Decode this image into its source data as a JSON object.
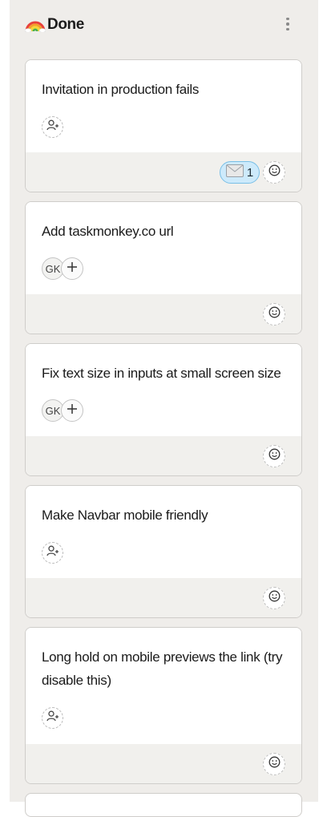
{
  "column": {
    "title": "Done",
    "emoji_icon": "rainbow-icon"
  },
  "cards": [
    {
      "title": "Invitation in production fails",
      "assignee_icon": "add-assignee-icon",
      "reaction": {
        "icon": "envelope-icon",
        "count": "1"
      },
      "add_reaction_icon": "smiley-icon"
    },
    {
      "title": "Add taskmonkey.co url",
      "assignee_initials": "GK",
      "add_assignee_icon": "plus-icon",
      "add_reaction_icon": "smiley-icon"
    },
    {
      "title": "Fix text size in inputs at small screen size",
      "assignee_initials": "GK",
      "add_assignee_icon": "plus-icon",
      "add_reaction_icon": "smiley-icon"
    },
    {
      "title": "Make Navbar mobile friendly",
      "assignee_icon": "add-assignee-icon",
      "add_reaction_icon": "smiley-icon"
    },
    {
      "title": "Long hold on mobile previews the link (try disable this)",
      "assignee_icon": "add-assignee-icon",
      "add_reaction_icon": "smiley-icon"
    }
  ]
}
